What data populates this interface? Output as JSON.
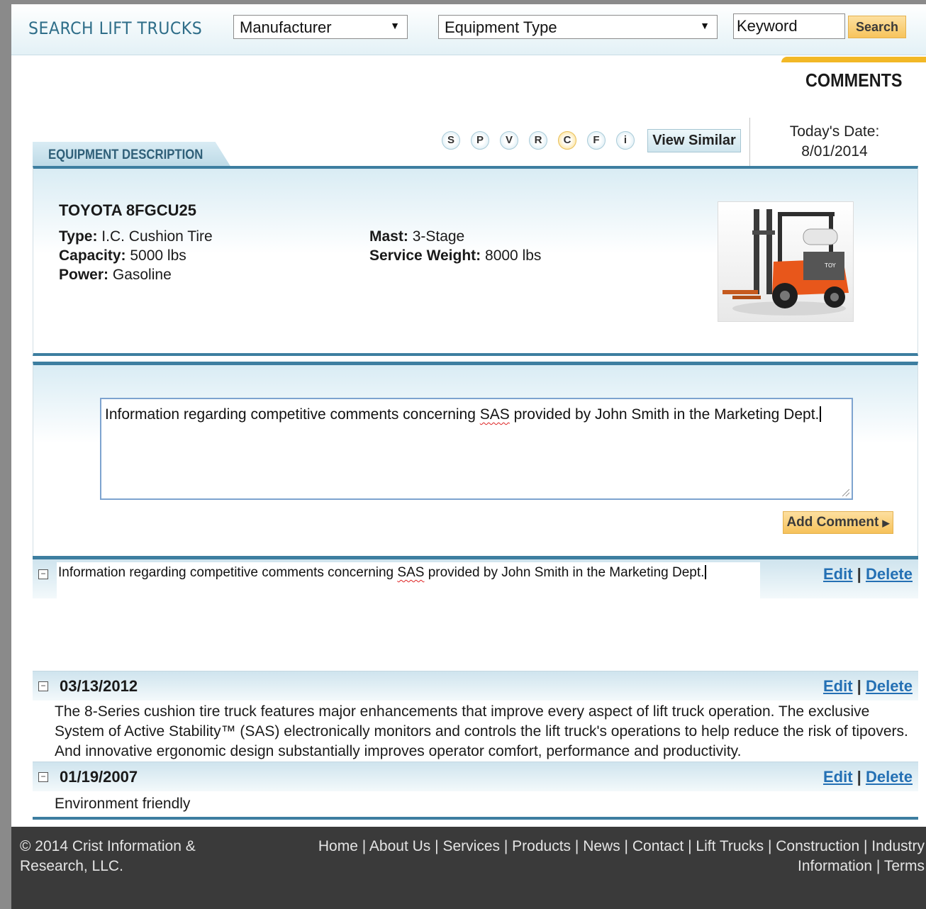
{
  "search": {
    "title": "SEARCH LIFT TRUCKS",
    "manufacturer": "Manufacturer",
    "equipment_type": "Equipment Type",
    "keyword": "Keyword",
    "button": "Search"
  },
  "header": {
    "comments_title": "COMMENTS"
  },
  "toolbar": {
    "icons": [
      "S",
      "P",
      "V",
      "R",
      "C",
      "F",
      "i"
    ],
    "active_icon": "C",
    "view_similar": "View Similar"
  },
  "date": {
    "label": "Today's Date:",
    "value": "8/01/2014"
  },
  "equipment": {
    "tab_label": "EQUIPMENT DESCRIPTION",
    "name": "TOYOTA 8FGCU25",
    "type_label": "Type:",
    "type_value": "I.C. Cushion Tire",
    "capacity_label": "Capacity:",
    "capacity_value": "5000 lbs",
    "power_label": "Power:",
    "power_value": "Gasoline",
    "mast_label": "Mast:",
    "mast_value": "3-Stage",
    "weight_label": "Service Weight:",
    "weight_value": "8000 lbs"
  },
  "comment_form": {
    "text_before": "Information regarding competitive comments concerning ",
    "misspelled": "SAS",
    "text_after": " provided by John Smith in the Marketing Dept.",
    "add_button": "Add Comment",
    "add_arrow": "▶"
  },
  "entries": [
    {
      "text_before": "Information regarding competitive comments concerning ",
      "misspelled": "SAS",
      "text_after": " provided by John Smith in the Marketing Dept.",
      "toggle": "−"
    },
    {
      "date": "03/13/2012",
      "toggle": "−",
      "body": "The 8-Series cushion tire truck features major enhancements that improve every aspect of lift truck operation. The exclusive System of Active Stability™ (SAS) electronically monitors and controls the lift truck's operations to help reduce the risk of tipovers. And innovative ergonomic design substantially improves operator comfort, performance and productivity."
    },
    {
      "date": "01/19/2007",
      "toggle": "−",
      "body": "Environment friendly"
    }
  ],
  "actions": {
    "edit": "Edit",
    "sep": "|",
    "delete": "Delete"
  },
  "footer": {
    "copyright": "© 2014 Crist Information & Research, LLC.",
    "links": [
      "Home",
      "About Us",
      "Services",
      "Products",
      "News",
      "Contact",
      "Lift Trucks",
      "Construction",
      "Industry Information",
      "Terms"
    ],
    "sep": "|"
  },
  "colors": {
    "accent_blue": "#3d7ea0",
    "button_orange": "#f7c45c",
    "link_blue": "#2470b4",
    "footer_bg": "#3a3a3a"
  }
}
